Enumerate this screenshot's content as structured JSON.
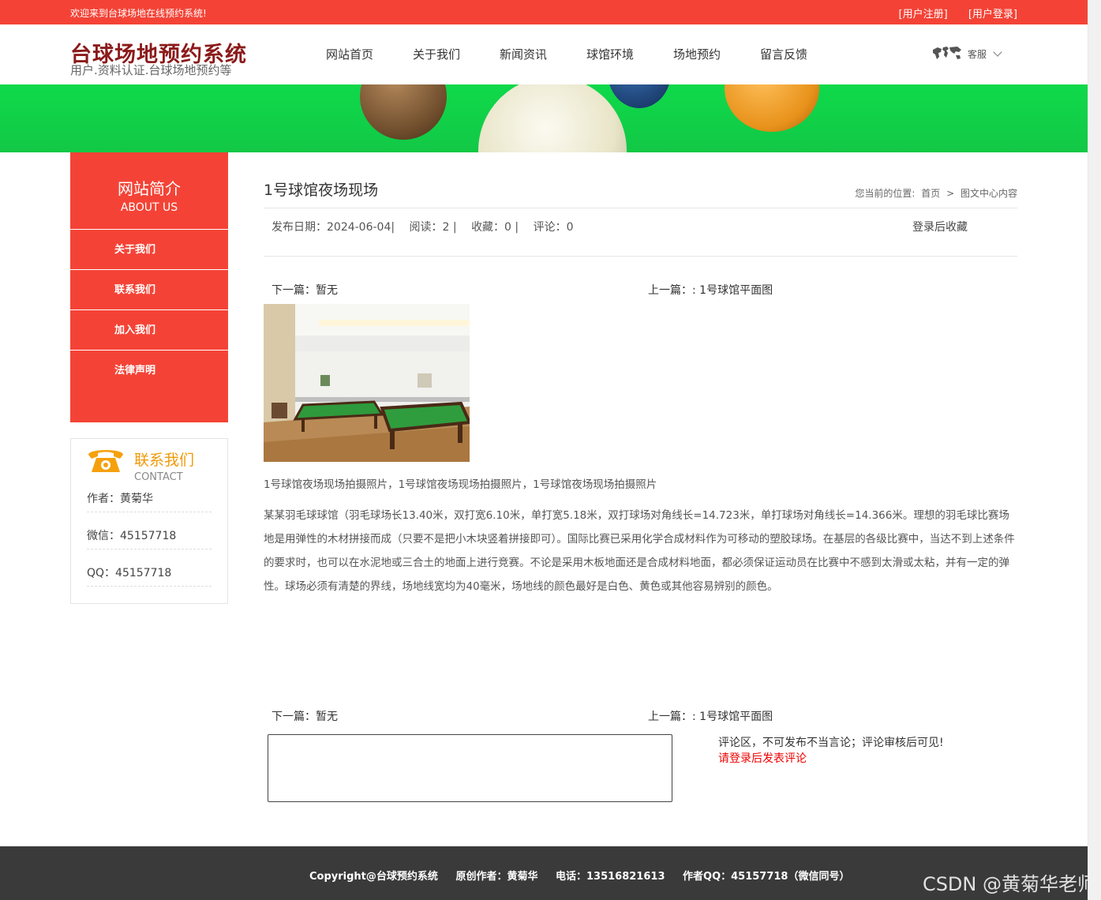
{
  "topbar": {
    "welcome": "欢迎来到台球场地在线预约系统!",
    "register": "[用户注册]",
    "login": "[用户登录]"
  },
  "header": {
    "logo_title": "台球场地预约系统",
    "logo_sub": "用户.资料认证.台球场地预约等",
    "nav": [
      "网站首页",
      "关于我们",
      "新闻资讯",
      "球馆环境",
      "场地预约",
      "留言反馈"
    ],
    "service": "客服"
  },
  "sidebar": {
    "title": "网站简介",
    "subtitle": "ABOUT US",
    "items": [
      "关于我们",
      "联系我们",
      "加入我们",
      "法律声明"
    ]
  },
  "contact": {
    "title": "联系我们",
    "subtitle": "CONTACT",
    "author": "作者：黄菊华",
    "wechat": "微信：45157718",
    "qq": "QQ：45157718"
  },
  "article": {
    "title": "1号球馆夜场现场",
    "breadcrumb_label": "您当前的位置:",
    "breadcrumb_home": "首页",
    "breadcrumb_sep": ">",
    "breadcrumb_current": "图文中心内容",
    "date": "发布日期：2024-06-04|",
    "reads": "阅读：2 |",
    "favorites": "收藏：0 |",
    "comments": "评论：0",
    "fav_action": "登录后收藏",
    "next": "下一篇：暂无",
    "prev": "上一篇：: 1号球馆平面图",
    "caption": "1号球馆夜场现场拍摄照片，1号球馆夜场现场拍摄照片，1号球馆夜场现场拍摄照片",
    "body": "某某羽毛球球馆（羽毛球场长13.40米，双打宽6.10米，单打宽5.18米，双打球场对角线长=14.723米，单打球场对角线长=14.366米。理想的羽毛球比赛场地是用弹性的木材拼接而成（只要不是把小木块竖着拼接即可）。国际比赛已采用化学合成材料作为可移动的塑胶球场。在基层的各级比赛中，当达不到上述条件的要求时，也可以在水泥地或三合土的地面上进行竞赛。不论是采用木板地面还是合成材料地面，都必须保证运动员在比赛中不感到太滑或太粘，并有一定的弹性。球场必须有清楚的界线，场地线宽均为40毫米，场地线的颜色最好是白色、黄色或其他容易辨别的颜色。"
  },
  "comment": {
    "note": "评论区，不可发布不当言论；评论审核后可见!",
    "login_link": "请登录后发表评论"
  },
  "footer": {
    "copyright": "Copyright@台球预约系统",
    "author": "原创作者：黄菊华",
    "phone": "电话：13516821613",
    "qq": "作者QQ：45157718（微信同号）"
  },
  "watermark": "CSDN @黄菊华老师"
}
